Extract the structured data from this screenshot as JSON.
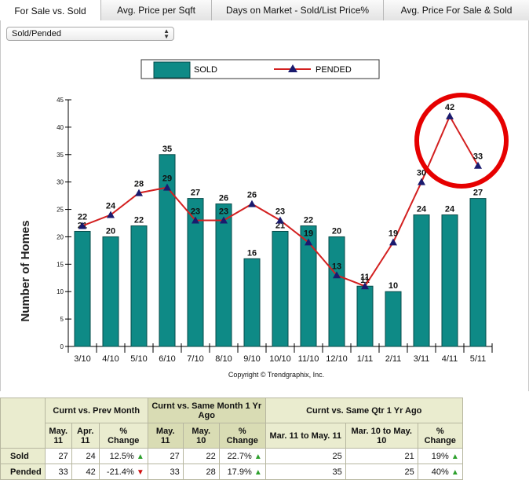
{
  "tabs": [
    {
      "label": "For Sale vs. Sold",
      "active": true
    },
    {
      "label": "Avg. Price per Sqft",
      "active": false
    },
    {
      "label": "Days on Market - Sold/List Price%",
      "active": false
    },
    {
      "label": "Avg. Price For Sale & Sold",
      "active": false
    }
  ],
  "selector": {
    "value": "Sold/Pended"
  },
  "chart_data": {
    "type": "bar+line",
    "categories": [
      "3/10",
      "4/10",
      "5/10",
      "6/10",
      "7/10",
      "8/10",
      "9/10",
      "10/10",
      "11/10",
      "12/10",
      "1/11",
      "2/11",
      "3/11",
      "4/11",
      "5/11"
    ],
    "series": [
      {
        "name": "SOLD",
        "type": "bar",
        "color": "#0e8a86",
        "values": [
          21,
          20,
          22,
          35,
          27,
          26,
          16,
          21,
          22,
          20,
          11,
          10,
          24,
          24,
          27
        ]
      },
      {
        "name": "PENDED",
        "type": "line",
        "color": "#d32020",
        "marker_color": "#1a1a6e",
        "values": [
          22,
          24,
          28,
          29,
          23,
          23,
          26,
          23,
          19,
          13,
          11,
          19,
          30,
          42,
          33
        ]
      }
    ],
    "ylabel": "Number of Homes",
    "ylim": [
      0,
      45
    ],
    "yticks": [
      0,
      5,
      10,
      15,
      20,
      25,
      30,
      35,
      40,
      45
    ],
    "legend_position": "top-center",
    "annotation": "red circle highlighting 4/11 and 5/11 pended values",
    "copyright": "Copyright © Trendgraphix, Inc."
  },
  "table": {
    "group_headers": {
      "prev_month": "Curnt vs. Prev Month",
      "year_ago": "Curnt vs. Same Month 1 Yr Ago",
      "qtr": "Curnt vs. Same Qtr 1 Yr Ago"
    },
    "col_headers": {
      "pm_a": "May. 11",
      "pm_b": "Apr. 11",
      "pm_c": "% Change",
      "ya_a": "May. 11",
      "ya_b": "May. 10",
      "ya_c": "% Change",
      "q_a": "Mar. 11 to May. 11",
      "q_b": "Mar. 10 to May. 10",
      "q_c": "% Change"
    },
    "rows": [
      {
        "label": "Sold",
        "pm_a": "27",
        "pm_b": "24",
        "pm_c": "12.5%",
        "pm_dir": "up",
        "ya_a": "27",
        "ya_b": "22",
        "ya_c": "22.7%",
        "ya_dir": "up",
        "q_a": "25",
        "q_b": "21",
        "q_c": "19%",
        "q_dir": "up"
      },
      {
        "label": "Pended",
        "pm_a": "33",
        "pm_b": "42",
        "pm_c": "-21.4%",
        "pm_dir": "down",
        "ya_a": "33",
        "ya_b": "28",
        "ya_c": "17.9%",
        "ya_dir": "up",
        "q_a": "35",
        "q_b": "25",
        "q_c": "40%",
        "q_dir": "up"
      }
    ]
  }
}
